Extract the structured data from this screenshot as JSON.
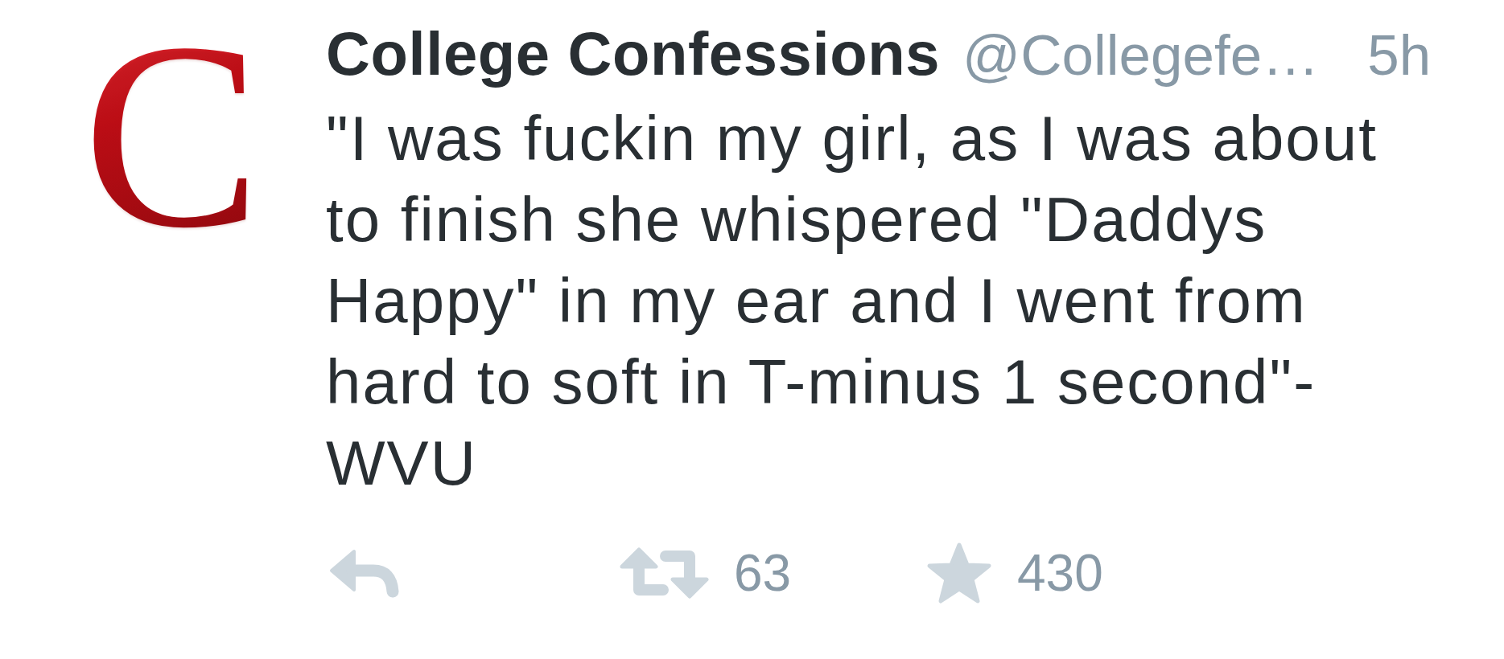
{
  "tweet": {
    "avatar": {
      "letter": "C"
    },
    "author": {
      "name": "College Confessions",
      "handle": "@Collegefe…"
    },
    "time": "5h",
    "text": "\"I was fuckin my girl, as I was about to finish she whispered \"Daddys Happy\" in my ear and I went from hard to soft in T-minus 1 second\"- WVU",
    "actions": [
      {
        "kind": "reply"
      },
      {
        "kind": "retweet",
        "count": "63"
      },
      {
        "kind": "favorite",
        "count": "430"
      }
    ]
  }
}
